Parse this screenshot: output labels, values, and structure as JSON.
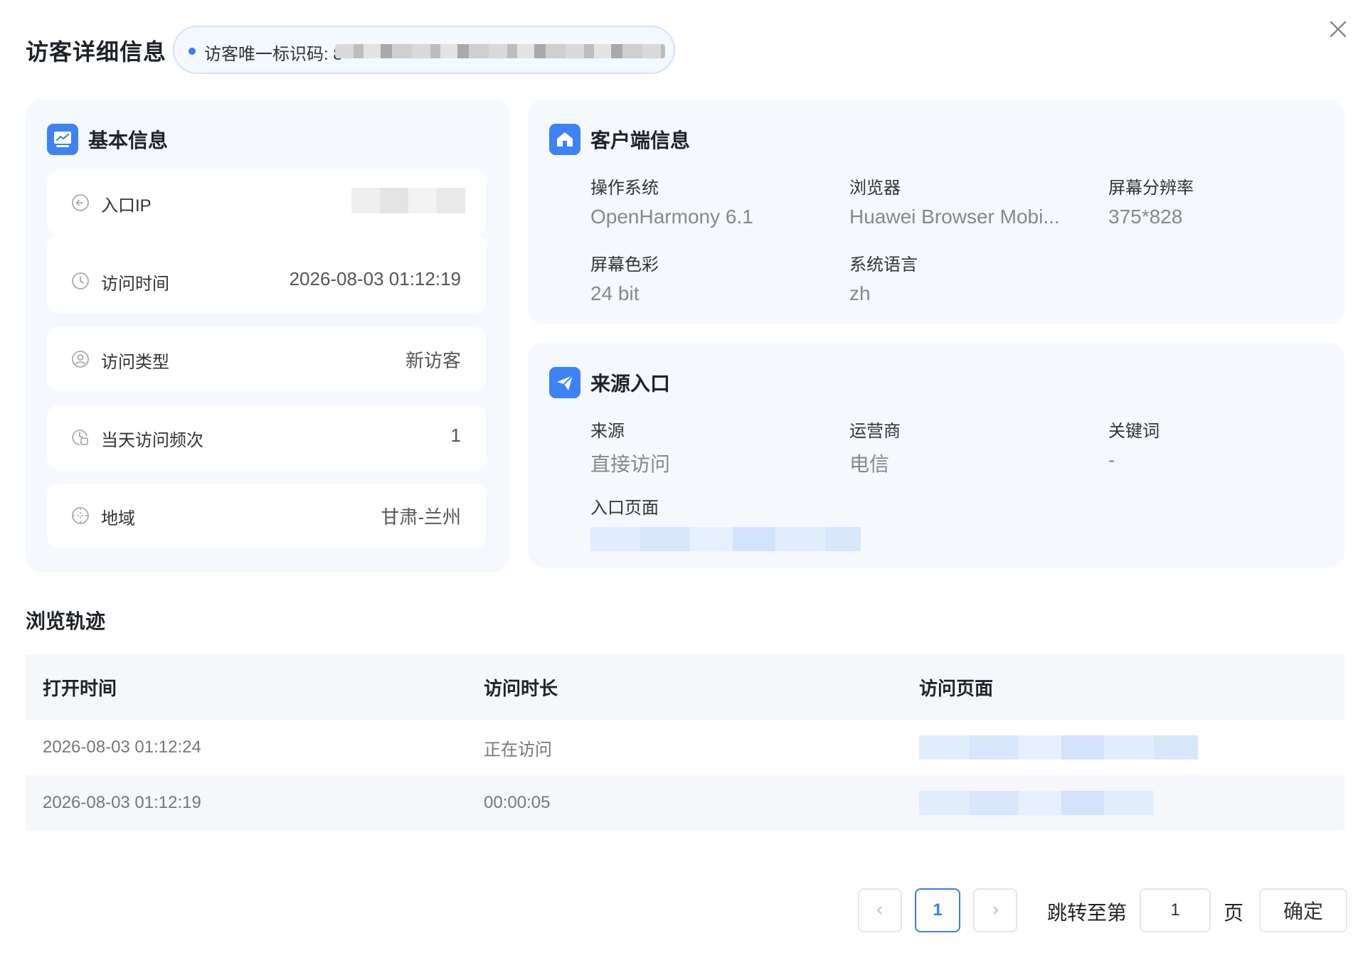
{
  "header": {
    "title": "访客详细信息",
    "uid_label": "访客唯一标识码: 8"
  },
  "basic": {
    "title": "基本信息",
    "rows": [
      {
        "label": "入口IP",
        "value": "",
        "icon": "login-arrow-icon"
      },
      {
        "label": "访问时间",
        "value": "2026-08-03 01:12:19",
        "icon": "clock-icon"
      },
      {
        "label": "访问类型",
        "value": "新访客",
        "icon": "user-circle-icon"
      },
      {
        "label": "当天访问频次",
        "value": "1",
        "icon": "calendar-clock-icon"
      },
      {
        "label": "地域",
        "value": "甘肃-兰州",
        "icon": "globe-icon"
      }
    ]
  },
  "client": {
    "title": "客户端信息",
    "fields": [
      {
        "label": "操作系统",
        "value": "OpenHarmony 6.1"
      },
      {
        "label": "浏览器",
        "value": "Huawei Browser Mobi..."
      },
      {
        "label": "屏幕分辨率",
        "value": "375*828"
      },
      {
        "label": "屏幕色彩",
        "value": "24 bit"
      },
      {
        "label": "系统语言",
        "value": "zh"
      }
    ]
  },
  "source": {
    "title": "来源入口",
    "fields": [
      {
        "label": "来源",
        "value": "直接访问"
      },
      {
        "label": "运营商",
        "value": "电信"
      },
      {
        "label": "关键词",
        "value": "-"
      },
      {
        "label": "入口页面",
        "value": ""
      }
    ]
  },
  "track": {
    "title": "浏览轨迹",
    "columns": [
      "打开时间",
      "访问时长",
      "访问页面"
    ],
    "rows": [
      {
        "open_time": "2026-08-03 01:12:24",
        "duration": "正在访问",
        "page": ""
      },
      {
        "open_time": "2026-08-03 01:12:19",
        "duration": "00:00:05",
        "page": ""
      }
    ]
  },
  "pagination": {
    "current": "1",
    "jump_label": "跳转至第",
    "jump_value": "1",
    "page_suffix": "页",
    "confirm": "确定"
  },
  "colors": {
    "accent": "#3a7cf2",
    "panel_bg": "#f5f8fd"
  }
}
